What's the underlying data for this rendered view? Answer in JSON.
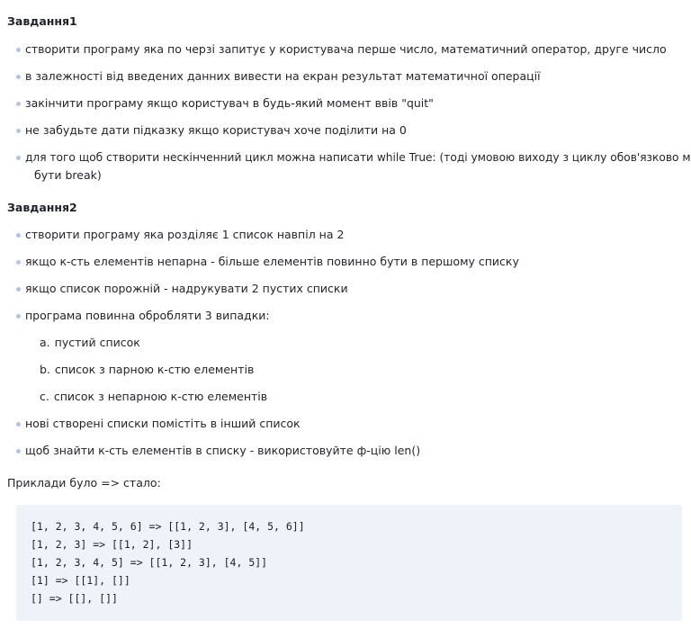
{
  "task1": {
    "title": "Завдання1",
    "items": [
      "створити програму яка по черзі запитує у користувача перше число, математичний оператор, друге число",
      "в залежності від введених данних вивести на екран результат математичної операції",
      "закінчити програму якщо користувач в будь-який момент ввів \"quit\"",
      "не забудьте дати підказку якщо користувач хоче поділити на 0",
      "для того щоб створити нескінченний цикл можна написати while True: (тоді умовою виходу з циклу обов'язково має"
    ],
    "item5_cont": "бути break)"
  },
  "task2": {
    "title": "Завдання2",
    "items": [
      "створити програму яка розділяє 1 список навпіл на 2",
      "якщо к-сть елементів непарна - більше елементів повинно бути в першому списку",
      "якщо список порожній - надрукувати 2 пустих списки",
      "програма повинна обробляти 3 випадки:"
    ],
    "subitems": [
      {
        "marker": "a.",
        "text": "пустий список"
      },
      {
        "marker": "b.",
        "text": "список з парною к-стю елементів"
      },
      {
        "marker": "c.",
        "text": "список з непарною к-стю елементів"
      }
    ],
    "items_after": [
      "нові створені списки помістіть в інший список",
      "щоб знайти к-сть елементів в списку - використовуйте ф-цію len()"
    ]
  },
  "examples_label": "Приклади було => стало:",
  "code_lines": [
    "[1, 2, 3, 4, 5, 6] => [[1, 2, 3], [4, 5, 6]]",
    "[1, 2, 3] => [[1, 2], [3]]",
    "[1, 2, 3, 4, 5] => [[1, 2, 3], [4, 5]]",
    "[1] => [[1], []]",
    "[] => [[], []]"
  ]
}
